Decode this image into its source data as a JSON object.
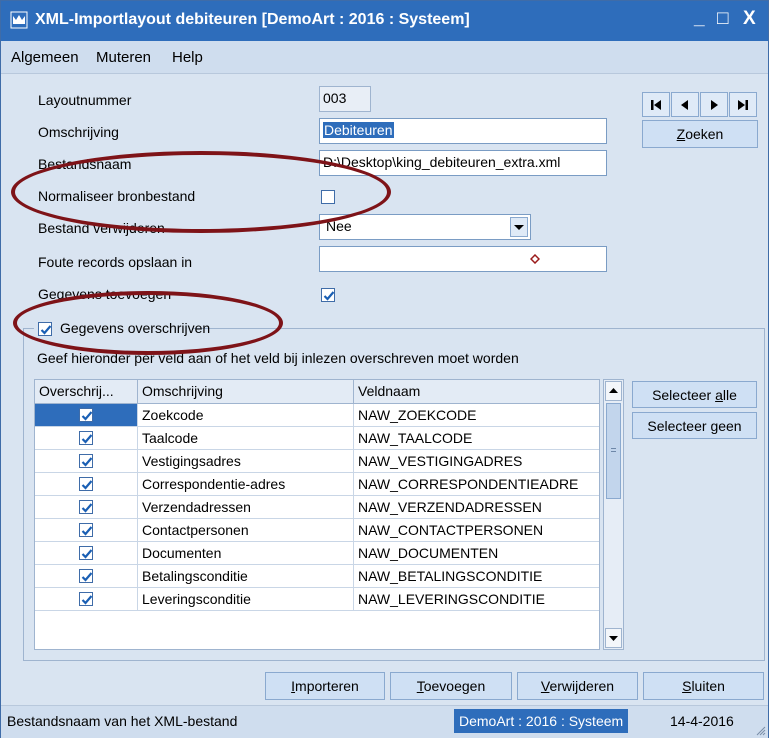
{
  "window": {
    "title": "XML-Importlayout debiteuren  [DemoArt : 2016 : Systeem]",
    "minimize_glyph": "_",
    "maximize_glyph": "□",
    "close_glyph": "X"
  },
  "menu": [
    "Algemeen",
    "Muteren",
    "Help"
  ],
  "form": {
    "layoutnummer_label": "Layoutnummer",
    "layoutnummer_value": "003",
    "omschrijving_label": "Omschrijving",
    "omschrijving_value": "Debiteuren",
    "bestandsnaam_label": "Bestandsnaam",
    "bestandsnaam_value": "D:\\Desktop\\king_debiteuren_extra.xml",
    "normaliseer_label": "Normaliseer bronbestand",
    "bestand_verwijderen_label": "Bestand verwijderen",
    "bestand_verwijderen_value": "Nee",
    "foute_records_label": "Foute records opslaan in",
    "foute_records_value": "",
    "gegevens_toevoegen_label": "Gegevens toevoegen"
  },
  "nav": {
    "zoeken_prefix": "",
    "zoeken_underline": "Z",
    "zoeken_rest": "oeken"
  },
  "group": {
    "title": "Gegevens overschrijven",
    "instruction": "Geef hieronder per veld aan of het veld bij inlezen overschreven moet worden"
  },
  "grid": {
    "columns": [
      "Overschrij...",
      "Omschrijving",
      "Veldnaam"
    ],
    "rows": [
      {
        "omschrijving": "Zoekcode",
        "veldnaam": "NAW_ZOEKCODE",
        "checked": true
      },
      {
        "omschrijving": "Taalcode",
        "veldnaam": "NAW_TAALCODE",
        "checked": true
      },
      {
        "omschrijving": "Vestigingsadres",
        "veldnaam": "NAW_VESTIGINGADRES",
        "checked": true
      },
      {
        "omschrijving": "Correspondentie-adres",
        "veldnaam": "NAW_CORRESPONDENTIEADRE",
        "checked": true
      },
      {
        "omschrijving": "Verzendadressen",
        "veldnaam": "NAW_VERZENDADRESSEN",
        "checked": true
      },
      {
        "omschrijving": "Contactpersonen",
        "veldnaam": "NAW_CONTACTPERSONEN",
        "checked": true
      },
      {
        "omschrijving": "Documenten",
        "veldnaam": "NAW_DOCUMENTEN",
        "checked": true
      },
      {
        "omschrijving": "Betalingsconditie",
        "veldnaam": "NAW_BETALINGSCONDITIE",
        "checked": true
      },
      {
        "omschrijving": "Leveringsconditie",
        "veldnaam": "NAW_LEVERINGSCONDITIE",
        "checked": true
      }
    ]
  },
  "side_buttons": {
    "selecteer_alle_a": "Selecteer ",
    "selecteer_alle_u": "a",
    "selecteer_alle_b": "lle",
    "selecteer_geen_a": "Selecteer ",
    "selecteer_geen_u": "g",
    "selecteer_geen_b": "een"
  },
  "bottom_buttons": {
    "importeren_u": "I",
    "importeren_rest": "mporteren",
    "toevoegen_u": "T",
    "toevoegen_rest": "oevoegen",
    "verwijderen_u": "V",
    "verwijderen_rest": "erwijderen",
    "sluiten_u": "S",
    "sluiten_rest": "luiten"
  },
  "status": {
    "message": "Bestandsnaam van het XML-bestand",
    "context": "DemoArt : 2016 : Systeem",
    "date": "14-4-2016"
  },
  "colors": {
    "titlebar": "#2e6dbb",
    "annotation_oval": "#7e1318",
    "selected_row": "#2e6dbb"
  }
}
